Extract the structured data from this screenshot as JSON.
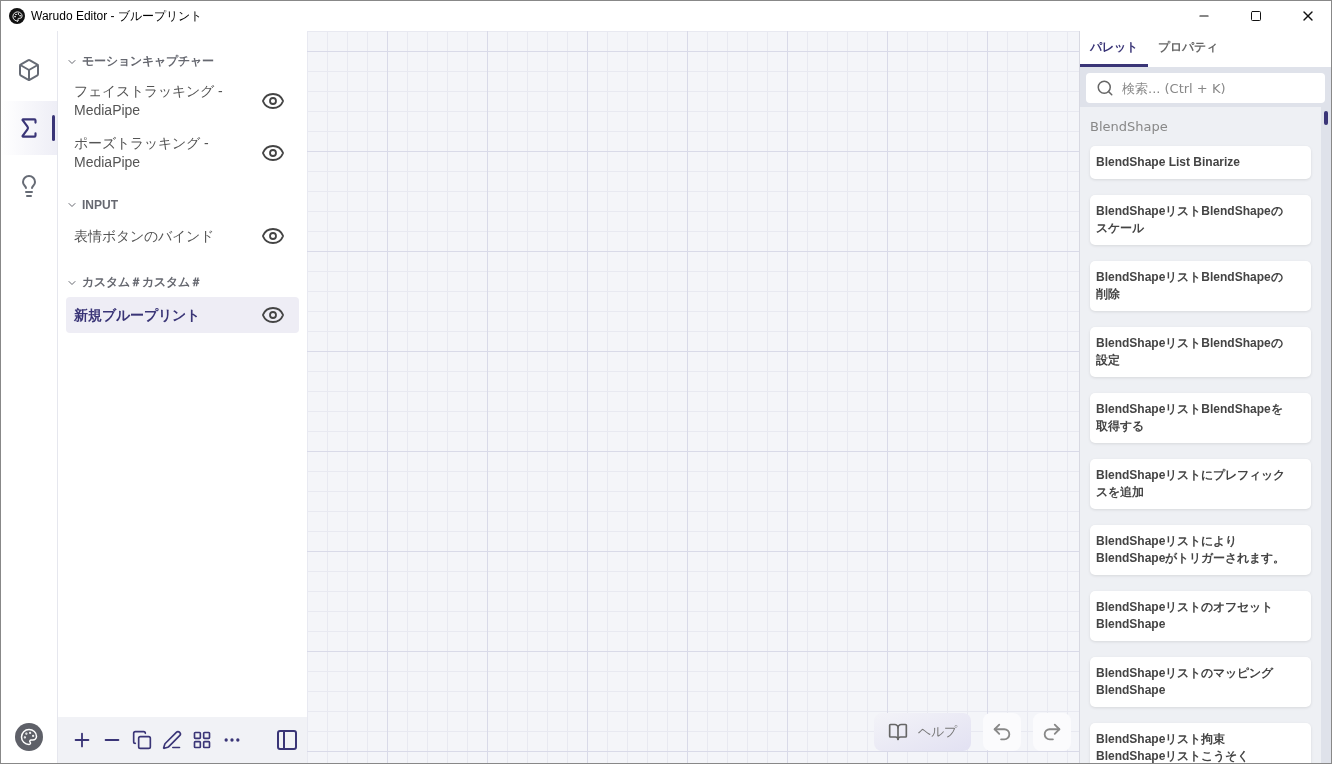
{
  "window": {
    "title": "Warudo Editor - ブループリント"
  },
  "rail": {
    "items": [
      {
        "kind": "cube",
        "selected": false
      },
      {
        "kind": "sigma",
        "selected": true
      },
      {
        "kind": "bulb",
        "selected": false
      }
    ]
  },
  "sidebar": {
    "groups": [
      {
        "title": "モーションキャプチャー",
        "expanded": true,
        "items": [
          {
            "label": "フェイストラッキング - MediaPipe",
            "selected": false
          },
          {
            "label": "ポーズトラッキング - MediaPipe",
            "selected": false
          }
        ]
      },
      {
        "title": "INPUT",
        "expanded": true,
        "items": [
          {
            "label": "表情ボタンのバインド",
            "selected": false
          }
        ]
      },
      {
        "title": "カスタム＃カスタム＃",
        "expanded": true,
        "items": [
          {
            "label": "新規ブループリント",
            "selected": true
          }
        ]
      }
    ]
  },
  "canvas": {
    "help_label": "ヘルプ"
  },
  "panel": {
    "tabs": [
      {
        "label": "パレット",
        "selected": true
      },
      {
        "label": "プロパティ",
        "selected": false
      }
    ],
    "search": {
      "placeholder": "検索... (Ctrl + K)"
    },
    "category": "BlendShape",
    "nodes": [
      {
        "lines": [
          "BlendShape List Binarize"
        ]
      },
      {
        "lines": [
          "BlendShapeリストBlendShapeの",
          "スケール"
        ]
      },
      {
        "lines": [
          "BlendShapeリストBlendShapeの",
          "削除"
        ]
      },
      {
        "lines": [
          "BlendShapeリストBlendShapeの",
          "設定"
        ]
      },
      {
        "lines": [
          "BlendShapeリストBlendShapeを",
          "取得する"
        ]
      },
      {
        "lines": [
          "BlendShapeリストにプレフィック",
          "スを追加"
        ]
      },
      {
        "lines": [
          "BlendShapeリストにより",
          "BlendShapeがトリガーされます。"
        ]
      },
      {
        "lines": [
          "BlendShapeリストのオフセット",
          "BlendShape"
        ]
      },
      {
        "lines": [
          "BlendShapeリストのマッピング",
          "BlendShape"
        ]
      },
      {
        "lines": [
          "BlendShapeリスト拘束",
          "BlendShapeリストこうそく"
        ]
      }
    ]
  }
}
